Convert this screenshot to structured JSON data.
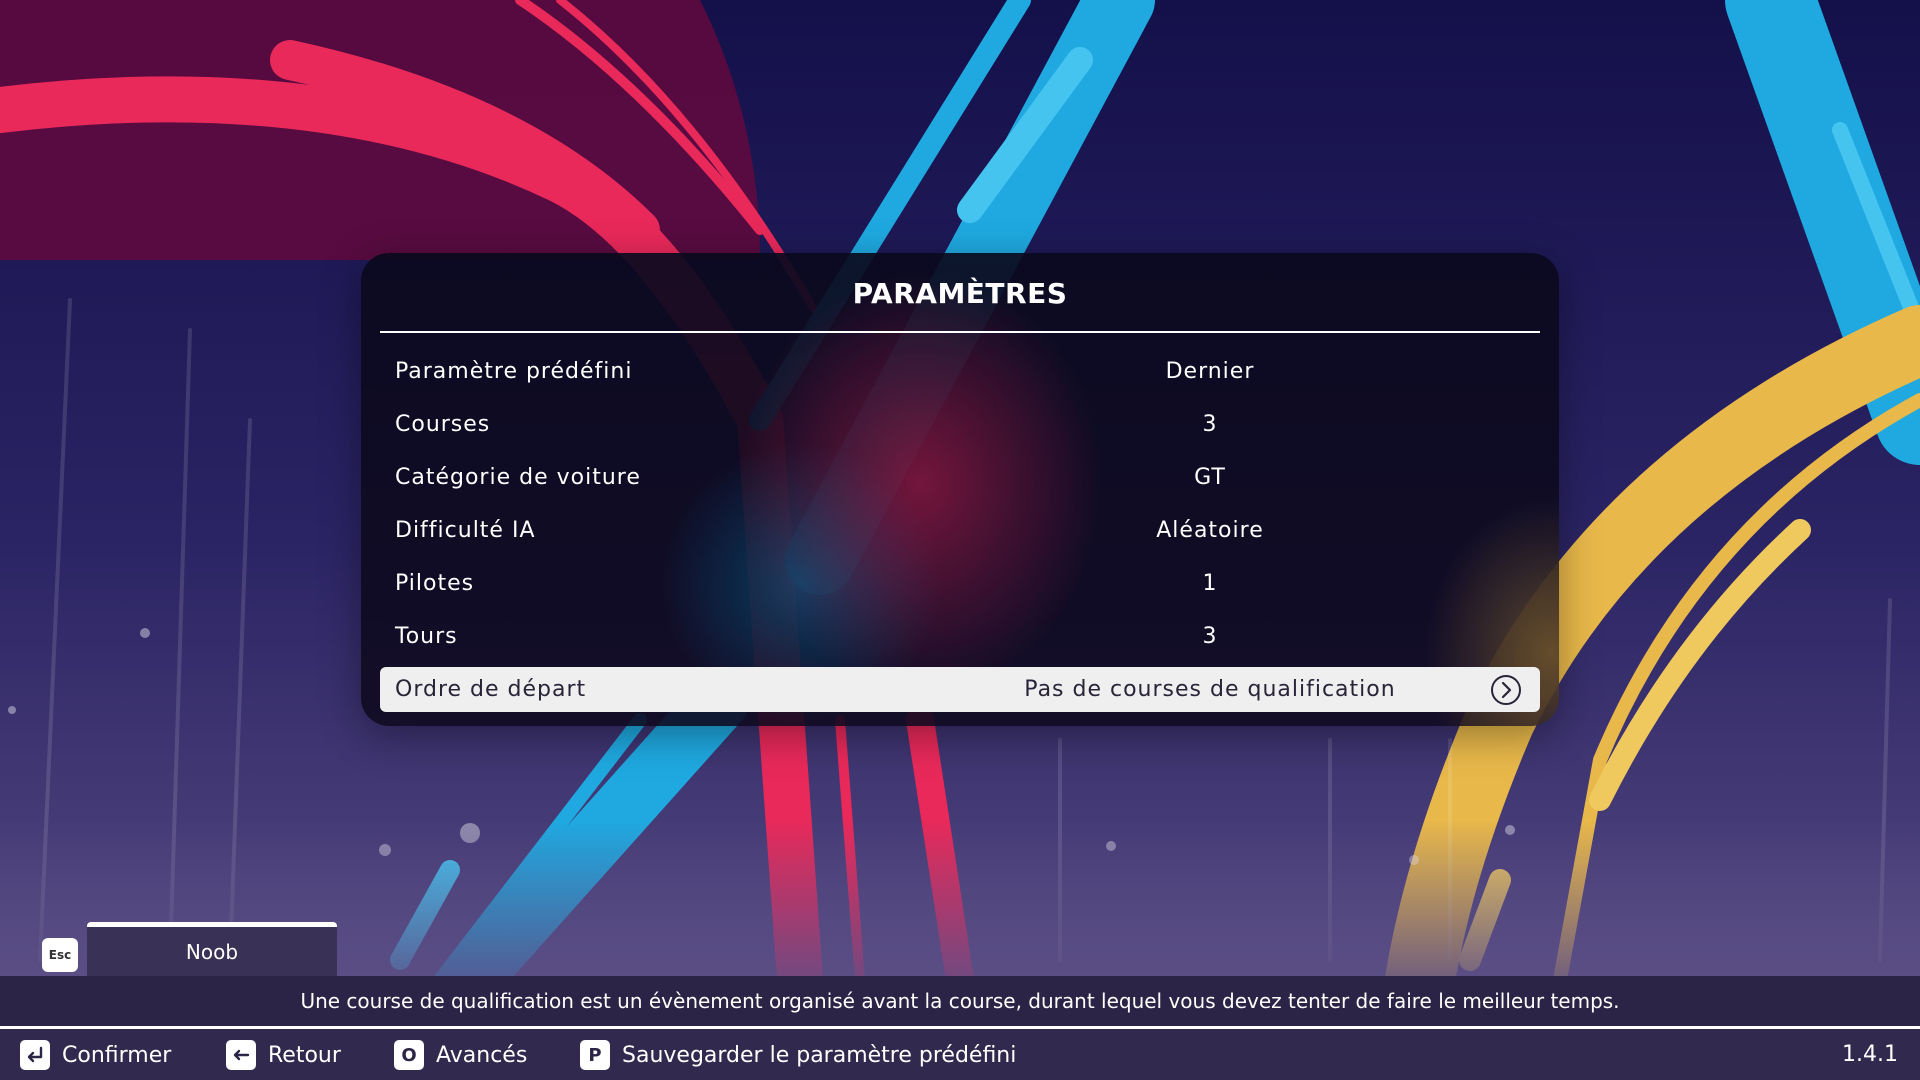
{
  "settings": {
    "title": "PARAMÈTRES",
    "rows": [
      {
        "label": "Paramètre prédéfini",
        "value": "Dernier"
      },
      {
        "label": "Courses",
        "value": "3"
      },
      {
        "label": "Catégorie de voiture",
        "value": "GT"
      },
      {
        "label": "Difficulté IA",
        "value": "Aléatoire"
      },
      {
        "label": "Pilotes",
        "value": "1"
      },
      {
        "label": "Tours",
        "value": "3"
      },
      {
        "label": "Ordre de départ",
        "value": "Pas de courses de qualification"
      }
    ]
  },
  "profile": {
    "esc_key": "Esc",
    "name": "Noob"
  },
  "hint": "Une course de qualification est un évènement organisé avant la course, durant lequel vous devez tenter de faire le meilleur temps.",
  "footer": {
    "confirm": "Confirmer",
    "back": "Retour",
    "advanced_key": "O",
    "advanced": "Avancés",
    "save_key": "P",
    "save_preset": "Sauvegarder le paramètre prédéfini",
    "version": "1.4.1"
  },
  "colors": {
    "background": "#1e1850",
    "red_stripe": "#e8295a",
    "blue_stripe": "#1fa9e0",
    "yellow_stripe": "#e8b84a",
    "selected_row": "#efefef"
  }
}
